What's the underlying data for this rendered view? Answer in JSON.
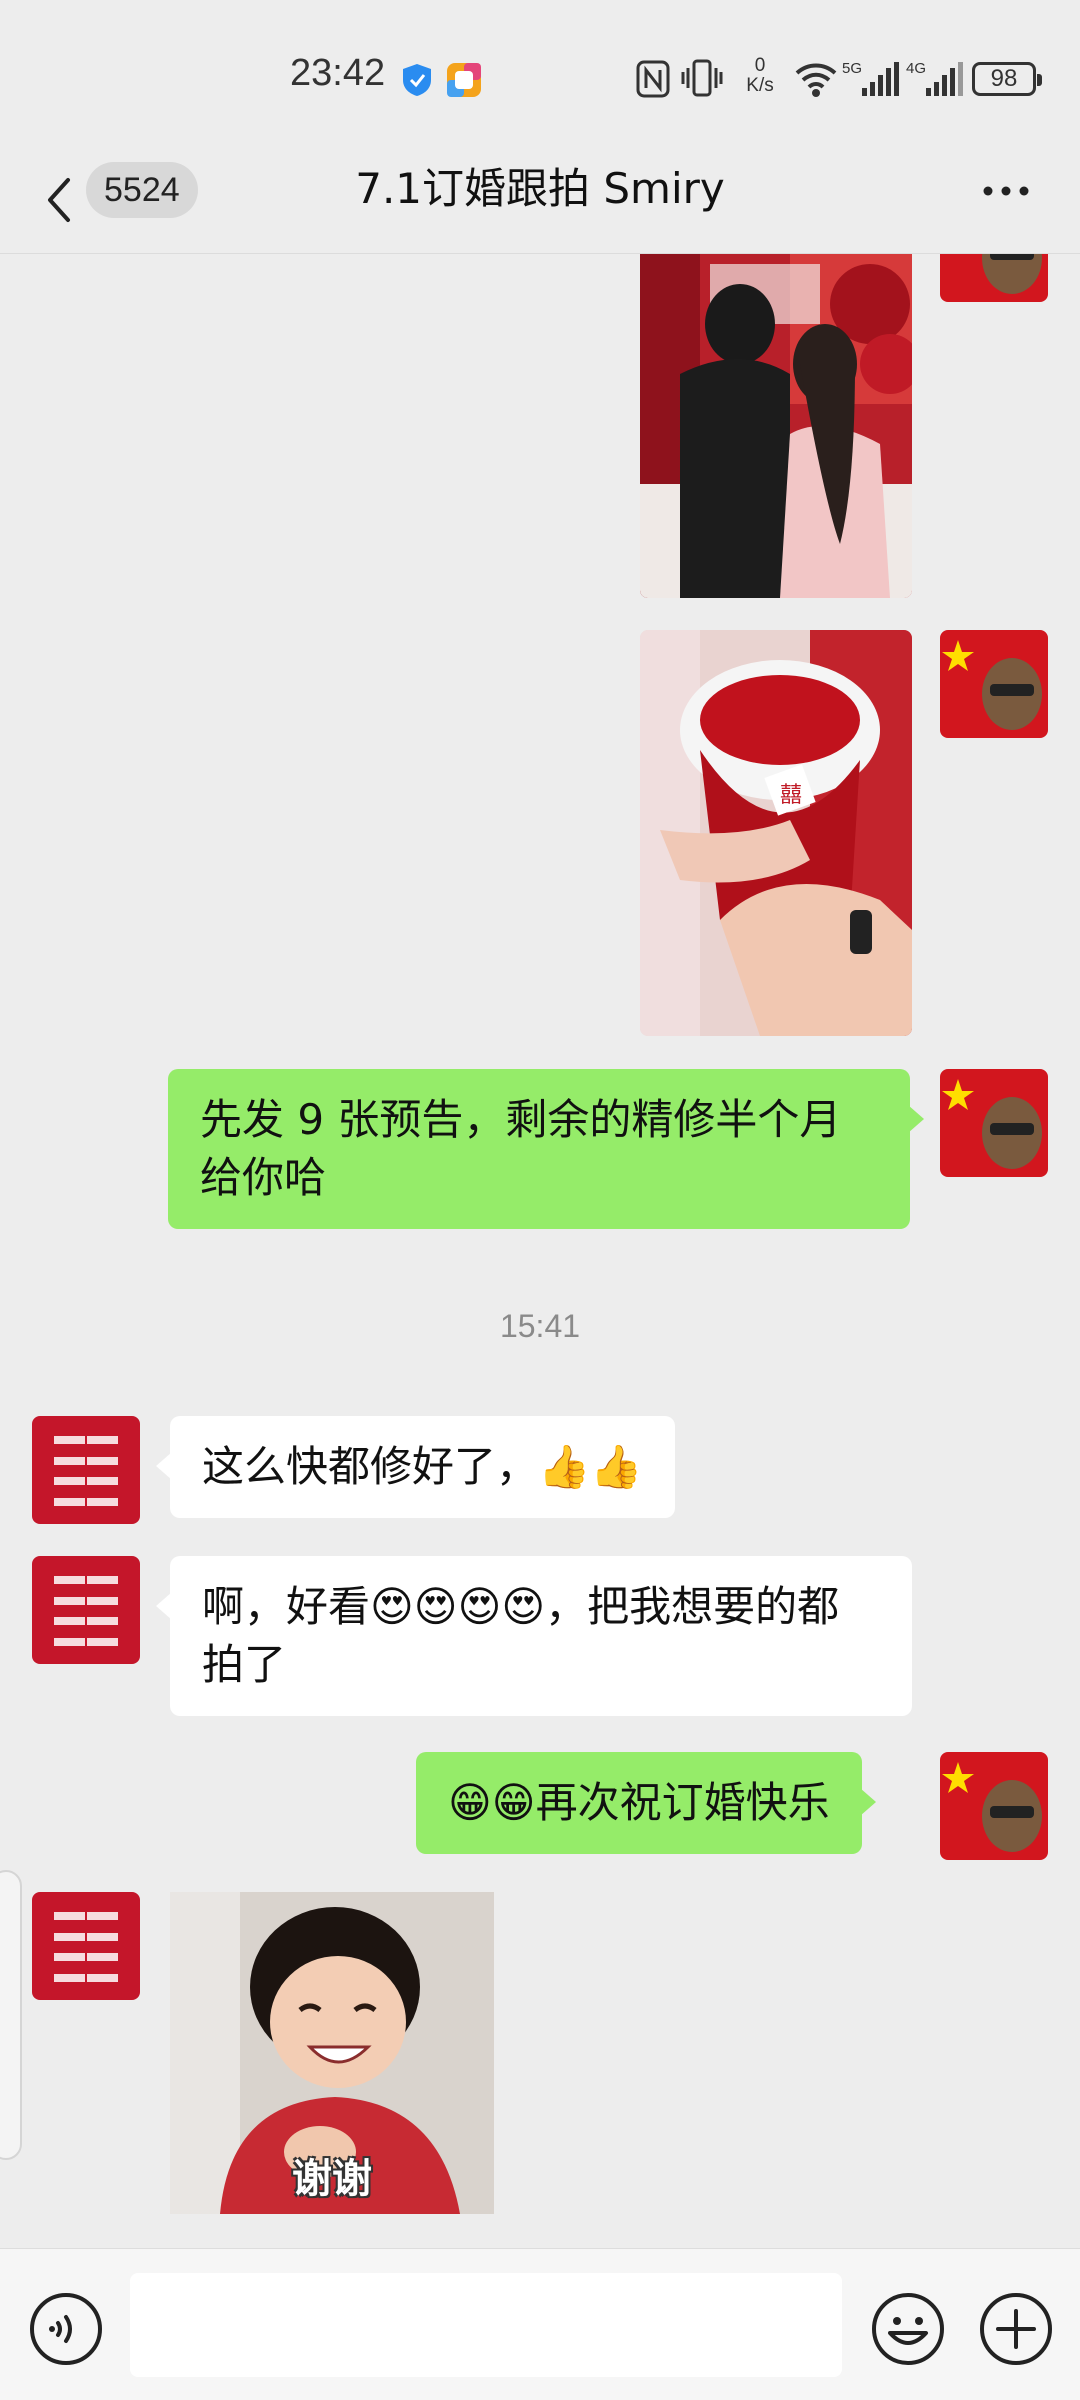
{
  "status_bar": {
    "time": "23:42",
    "net_speed_value": "0",
    "net_speed_unit": "K/s",
    "sim1_label": "5G",
    "sim2_label": "4G",
    "battery": "98"
  },
  "header": {
    "unread_count": "5524",
    "title": "7.1订婚跟拍  Smiry"
  },
  "messages": {
    "msg1_text": "先发 9 张预告，剩余的精修半个月给你哈",
    "timestamp": "15:41",
    "msg2_text": "这么快都修好了，👍👍",
    "msg3_text": "啊，好看😍😍😍😍，把我想要的都拍了",
    "msg4_text": "😁😁再次祝订婚快乐",
    "sticker_caption": "谢谢"
  },
  "input": {
    "placeholder": ""
  },
  "colors": {
    "my_bubble": "#95ec69",
    "other_bubble": "#ffffff",
    "background": "#ededed"
  }
}
